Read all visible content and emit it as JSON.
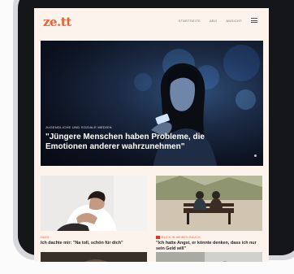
{
  "brand": {
    "logo": "ze.tt",
    "accent": "#e3643a",
    "page_bg": "#fbf3ec"
  },
  "nav": {
    "items": [
      "STARTSEITE",
      "ABO",
      "ANSICHT"
    ],
    "menu_icon": "hamburger-icon"
  },
  "hero": {
    "kicker": "Jugendliche und soziale Medien",
    "title": "\"Jüngere Menschen haben Probleme, die Emotionen anderer wahrzunehmen\""
  },
  "teasers": [
    {
      "tag": "Hass",
      "title": "Ich dachte mir: \"Na toll, schön für dich\""
    },
    {
      "tag": "Blick in meinen Bauch",
      "title": "\"Ich hatte Angst, er könnte denken, dass ich nur sein Geld will\""
    }
  ]
}
